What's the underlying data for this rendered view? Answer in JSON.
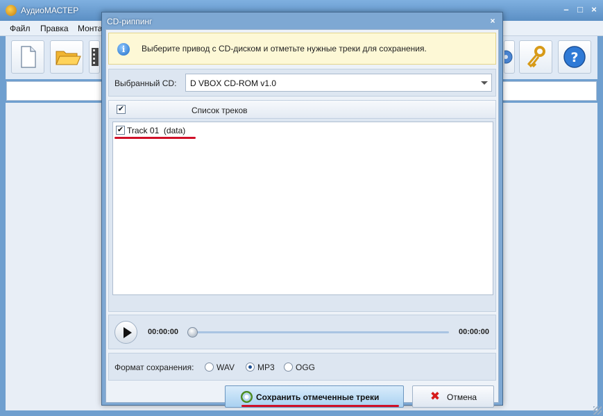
{
  "app": {
    "title": "АудиоМАСТЕР",
    "menu": [
      "Файл",
      "Правка",
      "Монта"
    ]
  },
  "dialog": {
    "title": "CD-риппинг",
    "close": "×",
    "info": "Выберите привод с CD-диском и отметьте нужные треки для сохранения.",
    "cd_label": "Выбранный CD:",
    "cd_value": "D VBOX CD-ROM v1.0",
    "tracks_header": "Список треков",
    "tracks": [
      {
        "label": "Track 01  (data)",
        "checked": true
      }
    ],
    "player": {
      "time_start": "00:00:00",
      "time_end": "00:00:00",
      "progress": 0
    },
    "format": {
      "label": "Формат сохранения:",
      "options": [
        "WAV",
        "MP3",
        "OGG"
      ],
      "selected": "MP3"
    },
    "save_button": "Сохранить отмеченные треки",
    "cancel_button": "Отмена"
  },
  "colors": {
    "title_bar": "#6f9fcf",
    "highlight_underline": "#d01028",
    "save_button": "#a9d1f1"
  },
  "icons": {
    "toolbar": [
      "new-file-icon",
      "open-folder-icon",
      "film-icon",
      "gear-icon",
      "keys-icon",
      "help-icon"
    ]
  }
}
